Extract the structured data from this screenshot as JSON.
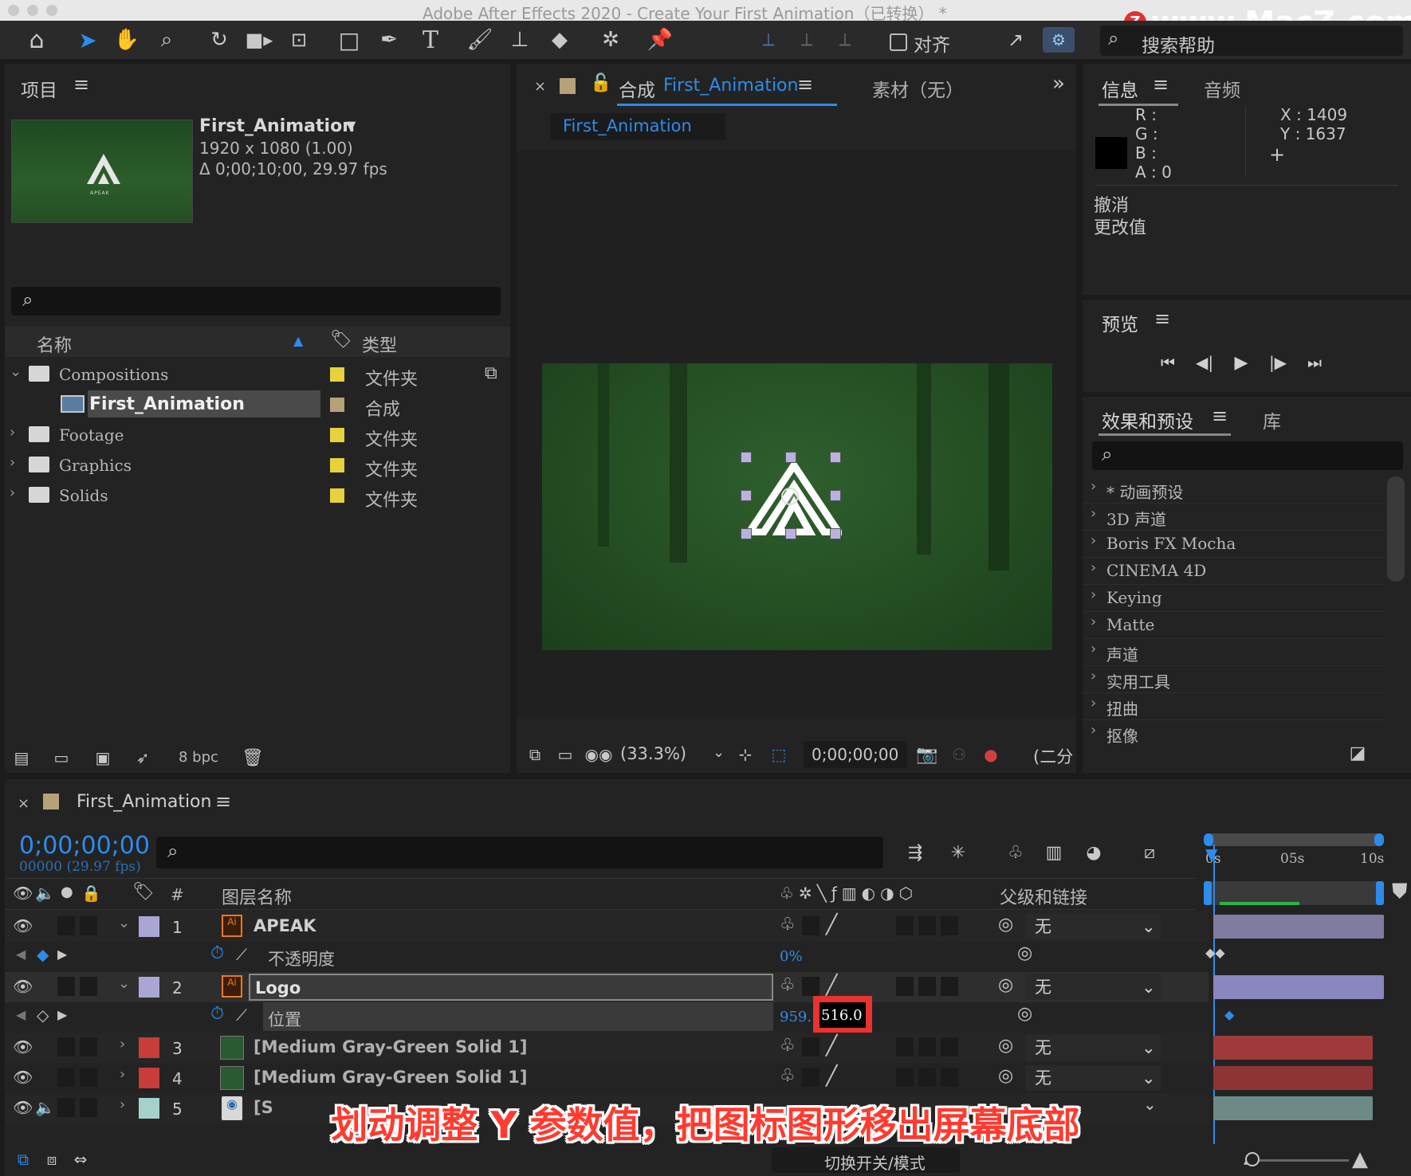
{
  "window": {
    "title": "Adobe After Effects 2020 - Create Your First Animation（已转换） *",
    "watermark": "www.MacZ.com"
  },
  "toolbar": {
    "align_label": "对齐",
    "search_label": "搜索帮助"
  },
  "project": {
    "title": "项目",
    "comp_name": "First_Animation",
    "comp_size": "1920 x 1080 (1.00)",
    "comp_duration": "Δ 0;00;10;00, 29.97 fps",
    "thumb_text": "APEAK",
    "col_name": "名称",
    "col_type": "类型",
    "items": [
      {
        "name": "Compositions",
        "type": "文件夹"
      },
      {
        "name": "First_Animation",
        "type": "合成"
      },
      {
        "name": "Footage",
        "type": "文件夹"
      },
      {
        "name": "Graphics",
        "type": "文件夹"
      },
      {
        "name": "Solids",
        "type": "文件夹"
      }
    ],
    "bpc": "8 bpc"
  },
  "composition": {
    "tab_prefix": "合成",
    "tab_name": "First_Animation",
    "footage_tab": "素材（无）",
    "subtab": "First_Animation",
    "zoom": "(33.3%)",
    "timecode": "0;00;00;00",
    "resolution": "(二分"
  },
  "info": {
    "title": "信息",
    "audio": "音频",
    "r": "R :",
    "g": "G :",
    "b": "B :",
    "a": "A :  0",
    "x": "X : 1409",
    "y": "Y :  1637",
    "undo": "撤消",
    "changed": "更改值"
  },
  "preview": {
    "title": "预览"
  },
  "effects": {
    "title": "效果和预设",
    "library": "库",
    "items": [
      "* 动画预设",
      "3D 声道",
      "Boris FX Mocha",
      "CINEMA 4D",
      "Keying",
      "Matte",
      "声道",
      "实用工具",
      "扭曲",
      "抠像"
    ]
  },
  "timeline": {
    "tab": "First_Animation",
    "timecode": "0;00;00;00",
    "frame": "00000 (29.97 fps)",
    "col_hash": "#",
    "col_layer": "图层名称",
    "col_parent": "父级和链接",
    "ruler": [
      "0s",
      "05s",
      "10s"
    ],
    "layers": [
      {
        "num": "1",
        "name": "APEAK",
        "parent": "无"
      },
      {
        "prop": "不透明度",
        "value": "0%"
      },
      {
        "num": "2",
        "name": "Logo",
        "parent": "无"
      },
      {
        "prop": "位置",
        "value_x": "959.",
        "value_y": "516.0"
      },
      {
        "num": "3",
        "name": "[Medium Gray-Green Solid 1]",
        "parent": "无"
      },
      {
        "num": "4",
        "name": "[Medium Gray-Green Solid 1]",
        "parent": "无"
      },
      {
        "num": "5",
        "name": "[S",
        "parent": ""
      }
    ],
    "footer_toggle": "切换开关/模式",
    "subtitle": "划动调整 Y 参数值，把图标图形移出屏幕底部"
  },
  "colors": {
    "accent": "#2d8ceb",
    "label_lavender": "#a9a6d6",
    "label_red": "#c83c3c",
    "label_teal": "#a5d1cc",
    "label_yellow": "#e6d23c",
    "label_tan": "#b6a27a"
  }
}
